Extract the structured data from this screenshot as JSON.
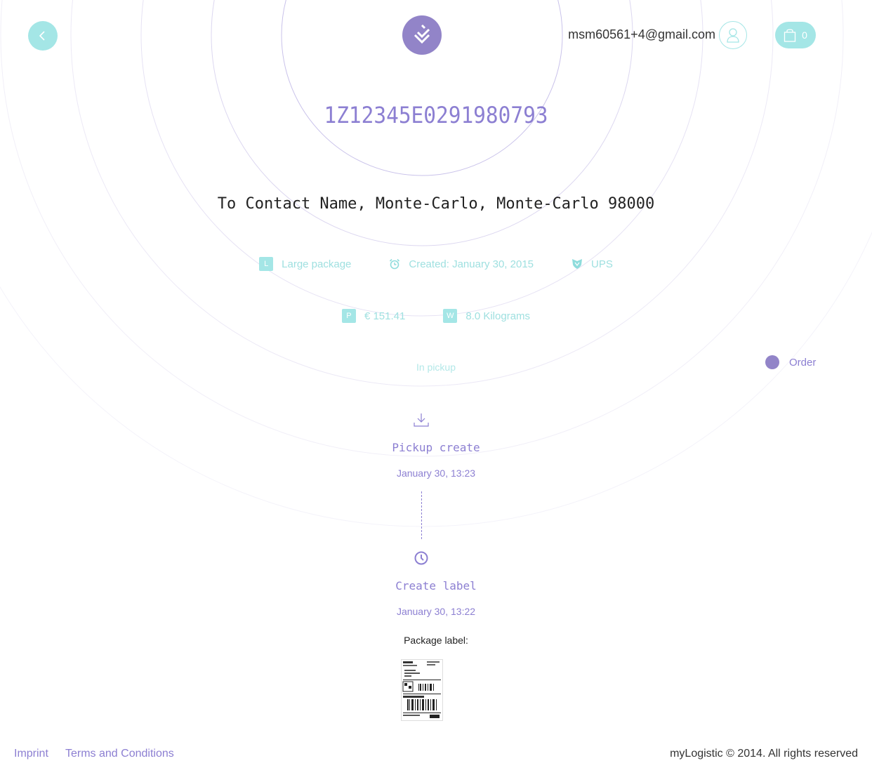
{
  "header": {
    "user_email": "msm60561+4@gmail.com",
    "cart_count": "0"
  },
  "shipment": {
    "tracking_number": "1Z12345E0291980793",
    "address": "To Contact Name, Monte-Carlo, Monte-Carlo 98000",
    "package_type_badge": "L",
    "package_type": "Large package",
    "created": "Created: January 30, 2015",
    "carrier": "UPS",
    "price_badge": "P",
    "price": "€ 151.41",
    "weight_badge": "W",
    "weight": "8.0 Kilograms",
    "status": "In pickup"
  },
  "legend": {
    "order_label": "Order"
  },
  "timeline": [
    {
      "title": "Pickup create",
      "date": "January 30, 13:23"
    },
    {
      "title": "Create label",
      "date": "January 30, 13:22"
    }
  ],
  "package_label_caption": "Package label:",
  "footer": {
    "imprint": "Imprint",
    "terms": "Terms and Conditions",
    "copyright": "myLogistic © 2014. All rights reserved"
  },
  "colors": {
    "accent_teal": "#a4e6e6",
    "accent_purple": "#8c7fd2"
  },
  "icons": {
    "back": "chevron-left-icon",
    "logo": "logo-icon",
    "user": "user-icon",
    "cart": "shopping-bag-icon",
    "created": "alarm-clock-icon",
    "carrier": "shield-icon",
    "pickup": "download-icon",
    "label": "clock-icon"
  }
}
